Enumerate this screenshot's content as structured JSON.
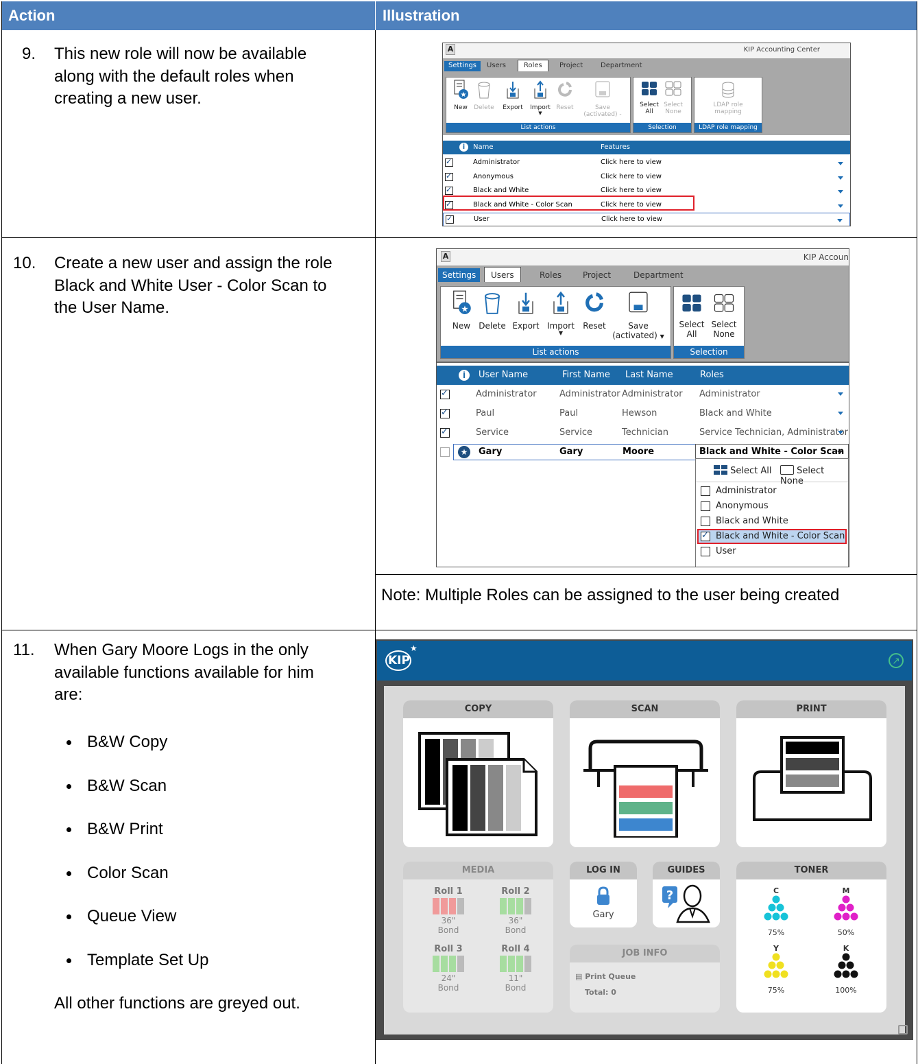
{
  "table": {
    "headers": [
      "Action",
      "Illustration"
    ],
    "rows": [
      {
        "step": "9.",
        "text": [
          "This new role will now be available",
          "along with the default roles when",
          "creating a new user."
        ]
      },
      {
        "step": "10.",
        "text": [
          "Create a new user and assign the role",
          "Black and White User - Color Scan to",
          "the User Name."
        ],
        "note": "Note: Multiple Roles can be assigned to the user being created"
      },
      {
        "step": "11.",
        "text": [
          "When Gary Moore Logs in the only",
          "available functions available for him",
          "are:"
        ],
        "bullets": [
          "B&W Copy",
          "B&W Scan",
          "B&W Print",
          "Color Scan",
          "Queue View",
          "Template Set Up"
        ],
        "footer": "All other functions are greyed out."
      }
    ]
  },
  "shot1": {
    "app_title": "KIP Accounting Center",
    "tabs": [
      "Settings",
      "Users",
      "Roles",
      "Project",
      "Department"
    ],
    "buttons": [
      "New",
      "Delete",
      "Export",
      "Import",
      "Reset",
      "Save",
      "(activated) -",
      "Select",
      "All",
      "Select",
      "None",
      "LDAP role",
      "mapping"
    ],
    "groups": [
      "List actions",
      "Selection",
      "LDAP role mapping"
    ],
    "columns": [
      "Name",
      "Features"
    ],
    "rows": [
      {
        "name": "Administrator",
        "features": "Click here to view"
      },
      {
        "name": "Anonymous",
        "features": "Click here to view"
      },
      {
        "name": "Black and White",
        "features": "Click here to view"
      },
      {
        "name": "Black and White - Color Scan",
        "features": "Click here to view"
      },
      {
        "name": "User",
        "features": "Click here to view"
      }
    ]
  },
  "shot2": {
    "app_title": "KIP Accoun",
    "tabs": [
      "Settings",
      "Users",
      "Roles",
      "Project",
      "Department"
    ],
    "buttons": [
      "New",
      "Delete",
      "Export",
      "Import",
      "Reset",
      "Save",
      "(activated)",
      "Select",
      "All",
      "Select",
      "None"
    ],
    "groups": [
      "List actions",
      "Selection"
    ],
    "columns": [
      "User Name",
      "First Name",
      "Last Name",
      "Roles"
    ],
    "rows": [
      {
        "user": "Administrator",
        "first": "Administrator",
        "last": "Administrator",
        "roles": "Administrator"
      },
      {
        "user": "Paul",
        "first": "Paul",
        "last": "Hewson",
        "roles": "Black and White"
      },
      {
        "user": "Service",
        "first": "Service",
        "last": "Technician",
        "roles": "Service Technician, Administrator"
      },
      {
        "user": "Gary",
        "first": "Gary",
        "last": "Moore",
        "roles": "Black and White - Color Scan"
      }
    ],
    "dropdown": {
      "select_all": "Select All",
      "select_none": "Select None",
      "options": [
        "Administrator",
        "Anonymous",
        "Black and White",
        "Black and White - Color Scan",
        "User"
      ]
    }
  },
  "kip": {
    "logo": "KIP",
    "cards": {
      "copy": "COPY",
      "scan": "SCAN",
      "print": "PRINT",
      "media": "MEDIA",
      "login": "LOG IN",
      "guides": "GUIDES",
      "toner": "TONER",
      "jobinfo": "JOB INFO"
    },
    "rolls": [
      {
        "name": "Roll 1",
        "size": "36\"",
        "type": "Bond"
      },
      {
        "name": "Roll 2",
        "size": "36\"",
        "type": "Bond"
      },
      {
        "name": "Roll 3",
        "size": "24\"",
        "type": "Bond"
      },
      {
        "name": "Roll 4",
        "size": "11\"",
        "type": "Bond"
      }
    ],
    "user": "Gary",
    "queue": "Print Queue",
    "total": "Total: 0",
    "toner": [
      {
        "label": "C",
        "pct": "75%",
        "color": "#17c3d8"
      },
      {
        "label": "M",
        "pct": "50%",
        "color": "#e020c8"
      },
      {
        "label": "Y",
        "pct": "75%",
        "color": "#f0e020"
      },
      {
        "label": "K",
        "pct": "100%",
        "color": "#111111"
      }
    ]
  }
}
